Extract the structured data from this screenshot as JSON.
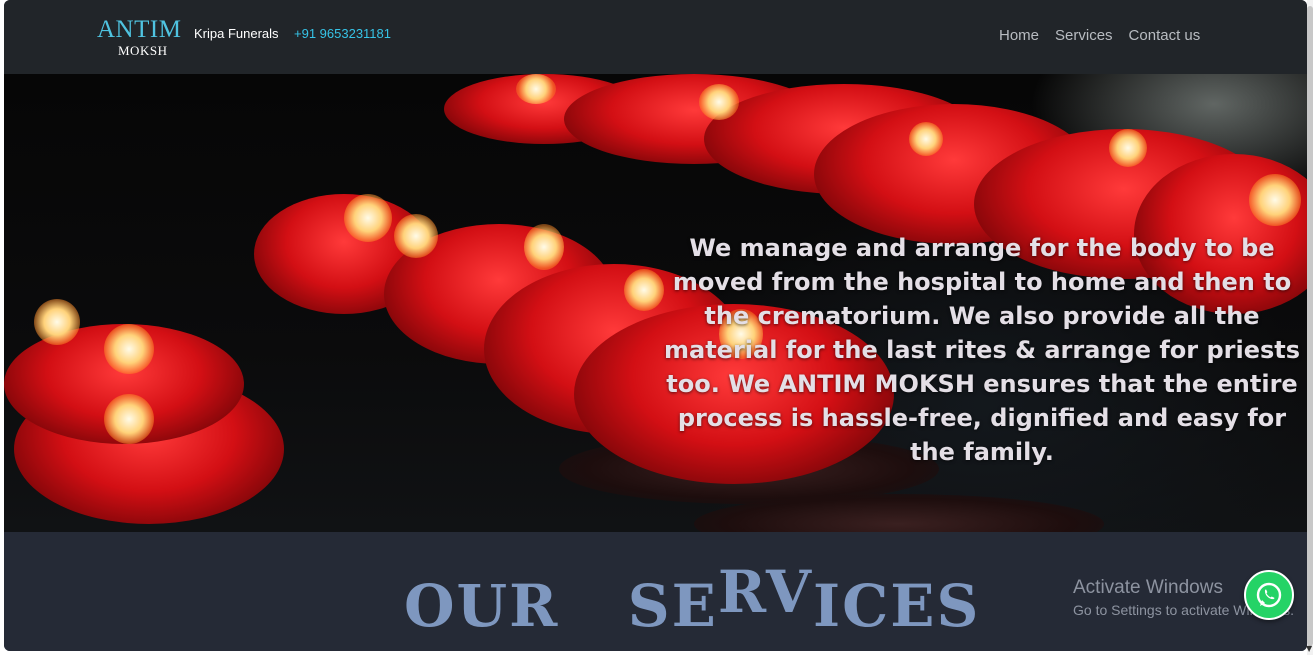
{
  "navbar": {
    "logo_top": "ANTIM",
    "logo_bottom": "MOKSH",
    "brand_sub": "Kripa Funerals",
    "phone": "+91 9653231181",
    "links": [
      {
        "label": "Home"
      },
      {
        "label": "Services"
      },
      {
        "label": "Contact us"
      }
    ]
  },
  "hero": {
    "text": "We manage and arrange for the body to be moved from the hospital to home and then to the crematorium. We also provide all the material for the last rites & arrange for priests too. We ANTIM MOKSH ensures that the entire process is hassle-free, dignified and easy for the family."
  },
  "services": {
    "title_part1": "OUR",
    "title_part2a": "SE",
    "title_part2b": "RV",
    "title_part2c": "ICES"
  },
  "windows_watermark": {
    "title": "Activate Windows",
    "subtitle": "Go to Settings to activate Windows."
  },
  "icons": {
    "whatsapp": "whatsapp-icon"
  },
  "colors": {
    "navbar_bg": "#212529",
    "logo": "#4fc3e0",
    "phone": "#36c3e6",
    "services_bg": "#252a36",
    "services_title": "#7e97bf",
    "whatsapp": "#25d366"
  }
}
